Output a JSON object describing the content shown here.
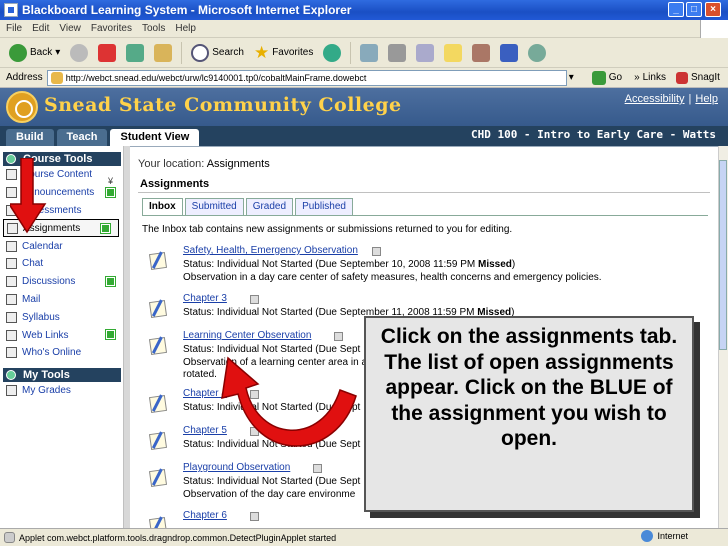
{
  "window": {
    "title": "Blackboard Learning System - Microsoft Internet Explorer"
  },
  "menu": [
    "File",
    "Edit",
    "View",
    "Favorites",
    "Tools",
    "Help"
  ],
  "toolbar": {
    "back": "Back",
    "search": "Search",
    "favorites": "Favorites"
  },
  "address": {
    "label": "Address",
    "url": "http://webct.snead.edu/webct/urw/lc9140001.tp0/cobaltMainFrame.dowebct",
    "go": "Go",
    "links": "Links",
    "snagit": "SnagIt"
  },
  "header": {
    "college": "Snead State Community College",
    "accessibility": "Accessibility",
    "divider": "|",
    "help": "Help",
    "course": "CHD 100 - Intro to Early Care - Watts"
  },
  "nav_tabs": [
    "Build",
    "Teach",
    "Student View"
  ],
  "sidebar": {
    "course_tools": "Course Tools",
    "items": [
      "Course Content",
      "Announcements",
      "Assessments",
      "Assignments",
      "Calendar",
      "Chat",
      "Discussions",
      "Mail",
      "Syllabus",
      "Web Links",
      "Who's Online"
    ],
    "my_tools": "My Tools",
    "my_items": [
      "My Grades"
    ]
  },
  "location": {
    "prefix": "Your location:",
    "current": "Assignments"
  },
  "page_title": "Assignments",
  "tabs": [
    "Inbox",
    "Submitted",
    "Graded",
    "Published"
  ],
  "description": "The Inbox tab contains new assignments or submissions returned to you for editing.",
  "assignments": [
    {
      "title": "Safety, Health, Emergency Observation",
      "status": "Status: Individual Not Started (Due September 10, 2008 11:59 PM ",
      "missed": "Missed",
      "status_end": ")",
      "desc": "Observation in a day care center of safety measures, health concerns and emergency policies."
    },
    {
      "title": "Chapter 3",
      "status": "Status: Individual Not Started (Due September 11, 2008 11:59 PM ",
      "missed": "Missed",
      "status_end": ")",
      "desc": ""
    },
    {
      "title": "Learning Center Observation",
      "status": "Status: Individual Not Started (Due Sept",
      "missed": "",
      "status_end": "",
      "desc": "Observation of a learning center area in a",
      "desc2": "rotated."
    },
    {
      "title": "Chapter 4",
      "status": "Status: Individual Not Started (Due Sept",
      "missed": "",
      "status_end": "",
      "desc": ""
    },
    {
      "title": "Chapter 5",
      "status": "Status: Individual Not Started (Due Sept",
      "missed": "",
      "status_end": "",
      "desc": ""
    },
    {
      "title": "Playground Observation",
      "status": "Status: Individual Not Started (Due Sept",
      "missed": "",
      "status_end": "",
      "desc": "Observation of the day care environme"
    },
    {
      "title": "Chapter 6",
      "status": "",
      "missed": "",
      "status_end": "",
      "desc": ""
    }
  ],
  "callout": "Click on the assignments tab.  The list of open assignments appear.  Click on the BLUE of the assignment you wish to open.",
  "statusbar": {
    "text": "Applet com.webct.platform.tools.dragndrop.common.DetectPluginApplet started",
    "zone": "Internet"
  },
  "colors": {
    "accent_blue": "#1a3fa8",
    "header_bg": "#365a8c",
    "college_gold": "#ffd24a",
    "arrow_red": "#e01010"
  }
}
